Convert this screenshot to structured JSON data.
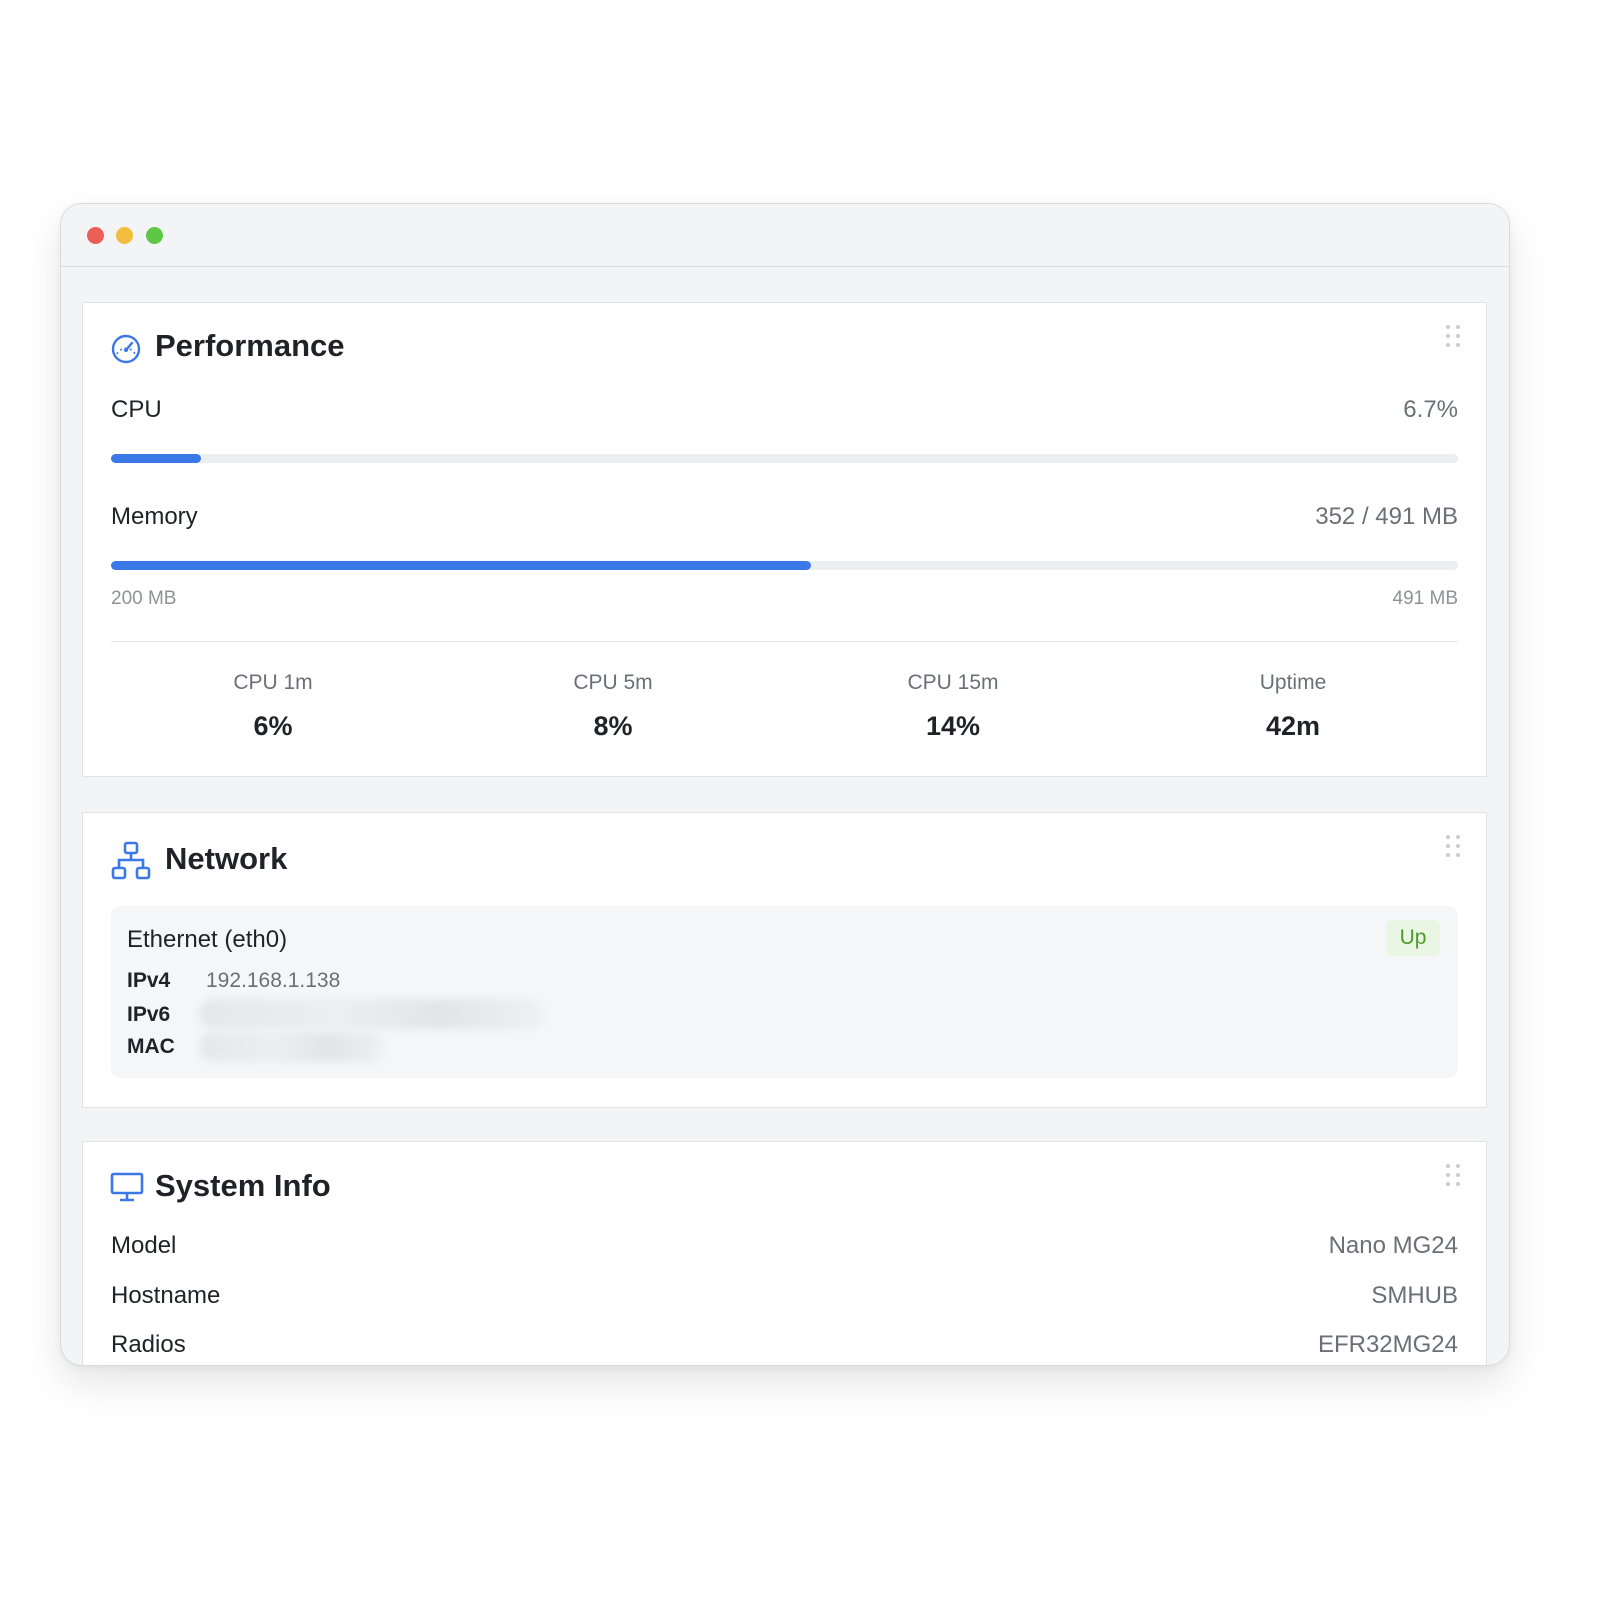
{
  "performance": {
    "title": "Performance",
    "cpu": {
      "label": "CPU",
      "value": "6.7%",
      "percent": 6.7
    },
    "memory": {
      "label": "Memory",
      "value": "352 / 491 MB",
      "used": 352,
      "total": 491,
      "fill_percent": 52,
      "min_label": "200 MB",
      "max_label": "491 MB"
    },
    "stats": [
      {
        "label": "CPU 1m",
        "value": "6%"
      },
      {
        "label": "CPU 5m",
        "value": "8%"
      },
      {
        "label": "CPU 15m",
        "value": "14%"
      },
      {
        "label": "Uptime",
        "value": "42m"
      }
    ]
  },
  "network": {
    "title": "Network",
    "interface": {
      "name": "Ethernet (eth0)",
      "status": "Up",
      "ipv4_label": "IPv4",
      "ipv4": "192.168.1.138",
      "ipv6_label": "IPv6",
      "mac_label": "MAC"
    }
  },
  "system": {
    "title": "System Info",
    "rows": [
      {
        "label": "Model",
        "value": "Nano MG24"
      },
      {
        "label": "Hostname",
        "value": "SMHUB"
      },
      {
        "label": "Radios",
        "value": "EFR32MG24"
      }
    ]
  },
  "icons": {
    "performance": "gauge-icon",
    "network": "network-icon",
    "system": "monitor-icon",
    "drag": "drag-handle-icon"
  },
  "colors": {
    "accent": "#3b78e7",
    "status_up_bg": "#eaf6e4",
    "status_up_text": "#4c9a2a"
  }
}
